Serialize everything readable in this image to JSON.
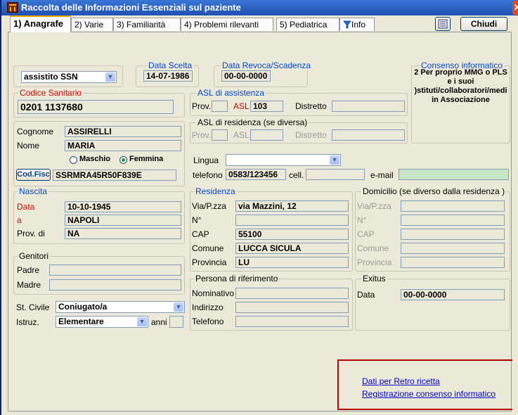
{
  "window": {
    "title": "Raccolta delle Informazioni Essenziali sul paziente"
  },
  "tabs": [
    "1) Anagrafe",
    "2) Varie",
    "3) Familiarità",
    "4) Problemi rilevanti",
    "5) Pediatrica",
    "Info"
  ],
  "toolbar": {
    "close_label": "Chiudi"
  },
  "assistito": {
    "value": "assistito SSN"
  },
  "data_scelta": {
    "label": "Data Scelta",
    "value": "14-07-1986"
  },
  "data_revoca": {
    "label": "Data Revoca/Scadenza",
    "value": "00-00-0000"
  },
  "consenso": {
    "label": "Consenso informatico",
    "text": "2 Per proprio MMG o PLS e i suoi )stituti/collaboratori/medi in Associazione"
  },
  "codice_sanitario": {
    "label": "Codice Sanitario",
    "value": "0201 1137680"
  },
  "asl_assistenza": {
    "label": "ASL di assistenza",
    "prov_label": "Prov.",
    "prov_value": "",
    "asl_label": "ASL",
    "asl_value": "103",
    "distretto_label": "Distretto",
    "distretto_value": ""
  },
  "asl_residenza": {
    "label": "ASL di residenza (se diversa)",
    "prov_label": "Prov.",
    "asl_label": "ASL",
    "distretto_label": "Distretto"
  },
  "anagrafica": {
    "cognome_label": "Cognome",
    "cognome": "ASSIRELLI",
    "nome_label": "Nome",
    "nome": "MARIA",
    "maschio_label": "Maschio",
    "femmina_label": "Femmina",
    "sesso": "Femmina",
    "codfisc_label": "Cod.Fisc",
    "codfisc": "SSRMRA45R50F839E"
  },
  "lingua": {
    "label": "Lingua",
    "value": ""
  },
  "contatti": {
    "telefono_label": "telefono",
    "telefono": "0583/123456",
    "cell_label": "cell.",
    "cell": "",
    "email_label": "e-mail",
    "email": ""
  },
  "nascita": {
    "label": "Nascita",
    "data_label": "Data",
    "data": "10-10-1945",
    "a_label": "a",
    "luogo": "NAPOLI",
    "prov_label": "Prov. di",
    "prov": "NA"
  },
  "residenza": {
    "label": "Residenza",
    "via_label": "Via/P.zza",
    "via": "via Mazzini, 12",
    "n_label": "N°",
    "n": "",
    "cap_label": "CAP",
    "cap": "55100",
    "comune_label": "Comune",
    "comune": "LUCCA SICULA",
    "provincia_label": "Provincia",
    "provincia": "LU"
  },
  "domicilio": {
    "label": "Domicilio (se diverso dalla residenza )",
    "via_label": "Via/P.zza",
    "n_label": "N°",
    "cap_label": "CAP",
    "comune_label": "Comune",
    "provincia_label": "Provincia"
  },
  "genitori": {
    "label": "Genitori",
    "padre_label": "Padre",
    "padre": "",
    "madre_label": "Madre",
    "madre": ""
  },
  "stato": {
    "civile_label": "St. Civile",
    "civile": "Coniugato/a",
    "istruz_label": "Istruz.",
    "istruz": "Elementare",
    "anni_label": "anni",
    "anni": ""
  },
  "riferimento": {
    "label": "Persona di riferimento",
    "nominativo_label": "Nominativo",
    "indirizzo_label": "Indirizzo",
    "telefono_label": "Telefono"
  },
  "exitus": {
    "label": "Exitus",
    "data_label": "Data",
    "data": "00-00-0000"
  },
  "links": {
    "retro_ricetta": "Dati per Retro ricetta",
    "registrazione_consenso": "Registrazione consenso informatico"
  },
  "colors": {
    "title_bar": "#1f4fb0",
    "panel": "#ece9d8",
    "legend_blue": "#0046d5",
    "required_red": "#d40000",
    "highlight": "#b00000"
  },
  "icons": {
    "app": "castle-icon",
    "info": "funnel-icon",
    "toolbar": "list-icon"
  }
}
